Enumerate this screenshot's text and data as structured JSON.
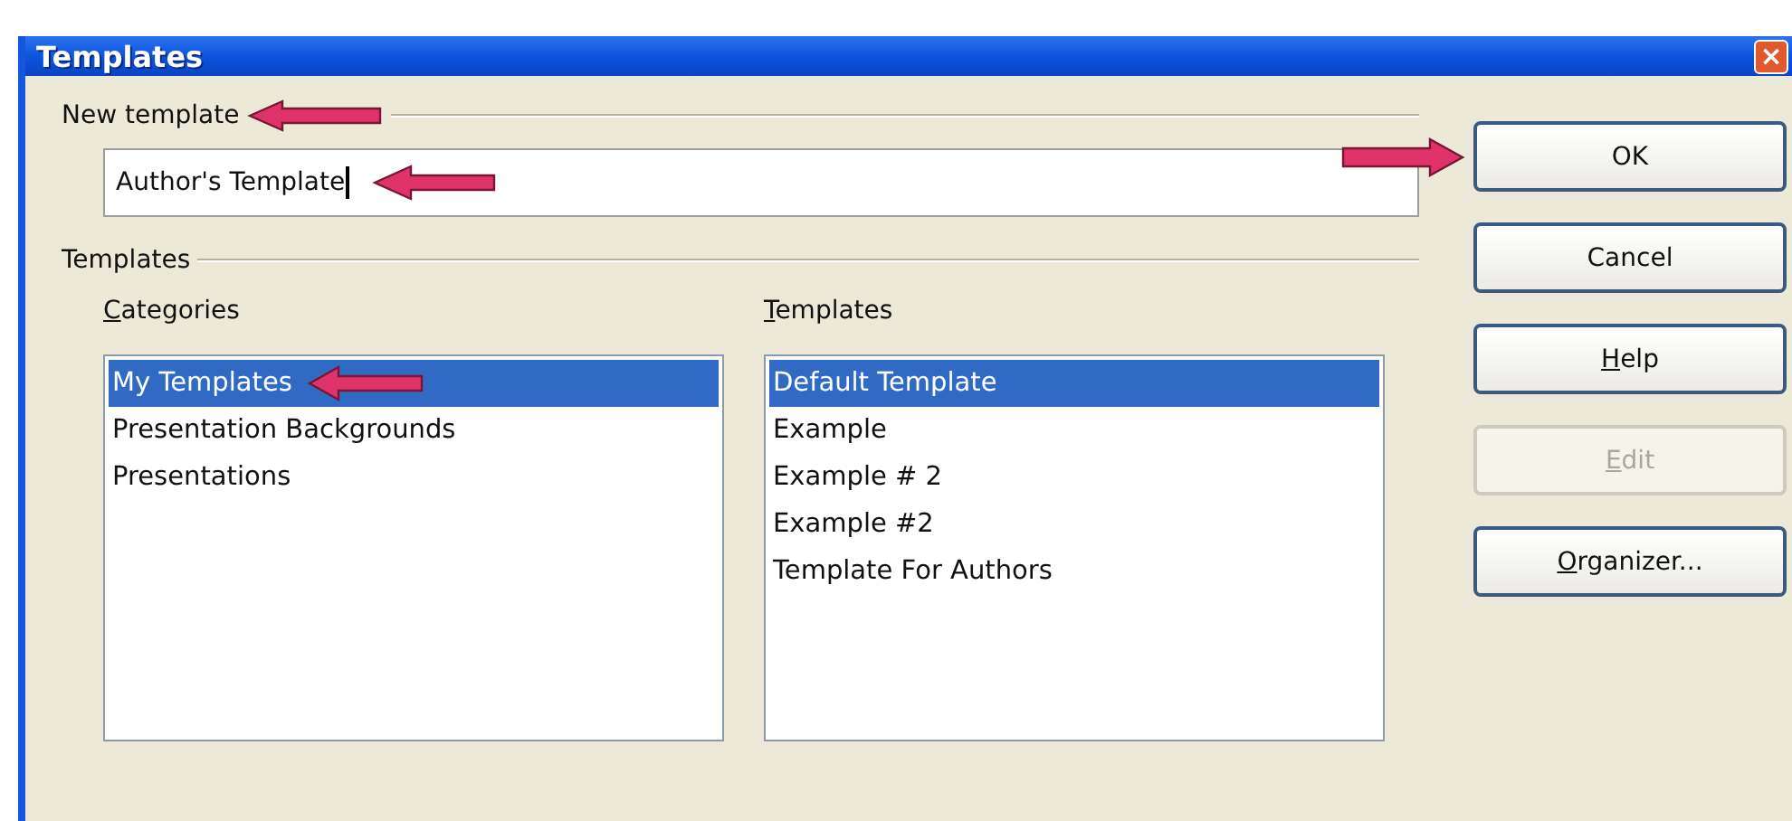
{
  "window": {
    "title": "Templates",
    "close": "×"
  },
  "new_template": {
    "label": "New template",
    "arrow": true,
    "value": "Author's Template",
    "value_arrow": true
  },
  "templates_section": {
    "label": "Templates",
    "categories": {
      "label": "Categories",
      "mnemonic": true,
      "items": [
        {
          "text": "My Templates",
          "selected": true,
          "arrow": true
        },
        {
          "text": "Presentation Backgrounds",
          "selected": false
        },
        {
          "text": "Presentations",
          "selected": false
        }
      ]
    },
    "templates": {
      "label": "Templates",
      "mnemonic": true,
      "items": [
        {
          "text": "Default Template",
          "selected": true
        },
        {
          "text": "Example",
          "selected": false
        },
        {
          "text": "Example # 2",
          "selected": false
        },
        {
          "text": "Example #2",
          "selected": false
        },
        {
          "text": "Template For Authors",
          "selected": false
        }
      ]
    }
  },
  "buttons": [
    {
      "label": "OK",
      "mnemonic": false,
      "disabled": false,
      "arrow": true
    },
    {
      "label": "Cancel",
      "mnemonic": false,
      "disabled": false
    },
    {
      "label": "Help",
      "mnemonic": true,
      "disabled": false
    },
    {
      "label": "Edit",
      "mnemonic": true,
      "disabled": true
    },
    {
      "label": "Organizer...",
      "mnemonic": true,
      "disabled": false
    }
  ]
}
